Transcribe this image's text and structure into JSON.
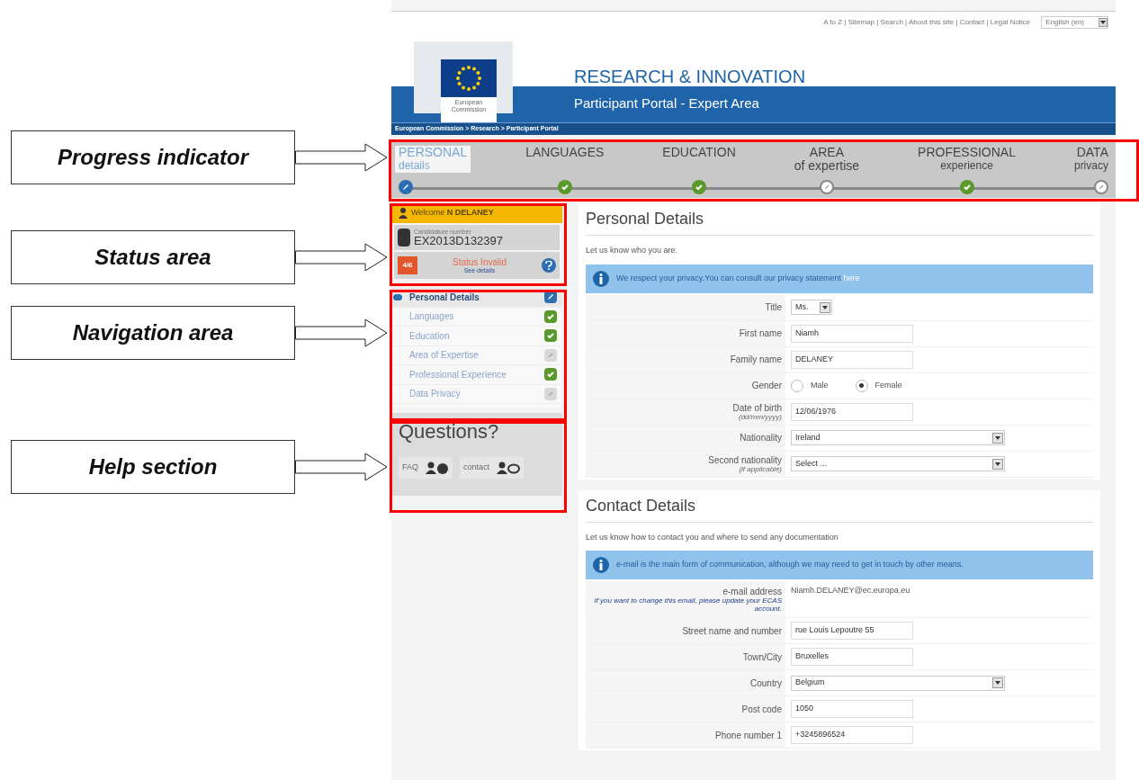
{
  "annotations": [
    {
      "label": "Progress indicator"
    },
    {
      "label": "Status area"
    },
    {
      "label": "Navigation area"
    },
    {
      "label": "Help section"
    }
  ],
  "top_links": "A to Z | Sitemap | Search | About this site | Contact | Legal Notice",
  "language": "English (en)",
  "logo_text": "European Commission",
  "site_title": "RESEARCH & INNOVATION",
  "site_subtitle": "Participant Portal - Expert Area",
  "breadcrumb": "European Commission > Research > Participant Portal",
  "steps": [
    {
      "title": "PERSONAL",
      "subtitle": "details",
      "selected": true,
      "kind": "editing"
    },
    {
      "title": "LANGUAGES",
      "selected": false,
      "kind": "complete"
    },
    {
      "title": "EDUCATION",
      "selected": false,
      "kind": "complete"
    },
    {
      "title": "AREA",
      "subtitle": "of expertise",
      "selected": false,
      "kind": "incomplete"
    },
    {
      "title": "PROFESSIONAL",
      "subtitle": "experience",
      "selected": false,
      "kind": "complete"
    },
    {
      "title": "DATA",
      "subtitle": "privacy",
      "selected": false,
      "kind": "incomplete"
    }
  ],
  "status_area": {
    "welcome": "Welcome **N DELANEY**",
    "candidature_label": "Candidature number",
    "candidature_number": "EX2013D132397",
    "progress": "4/6",
    "status": "Status Invalid",
    "status_link": "See details"
  },
  "nav": [
    {
      "label": "Personal Details",
      "selected": true,
      "kind": "editing"
    },
    {
      "label": "Languages",
      "selected": false,
      "kind": "complete"
    },
    {
      "label": "Education",
      "selected": false,
      "kind": "complete"
    },
    {
      "label": "Area of Expertise",
      "selected": false,
      "kind": "incomplete"
    },
    {
      "label": "Professional Experience",
      "selected": false,
      "kind": "complete"
    },
    {
      "label": "Data Privacy",
      "selected": false,
      "kind": "incomplete"
    }
  ],
  "help": {
    "title": "Questions?",
    "links": [
      {
        "label": "FAQ",
        "kind": "faq"
      },
      {
        "label": "contact",
        "kind": "contact"
      }
    ]
  },
  "sections": [
    {
      "title": "Personal Details",
      "intro": "Let us know who you are.",
      "info": "We respect your privacy.You can consult our privacy statement",
      "info_link": "here",
      "fields": [
        {
          "label": "Title",
          "kind": "small_select",
          "value": "Ms."
        },
        {
          "label": "First name",
          "kind": "text",
          "value": "Niamh"
        },
        {
          "label": "Family name",
          "kind": "text",
          "value": "DELANEY"
        },
        {
          "label": "Gender",
          "kind": "radio",
          "options": [
            {
              "label": "Male",
              "selected": false
            },
            {
              "label": "Female",
              "selected": true
            }
          ]
        },
        {
          "label": "Date of birth",
          "hint": "(dd/mm/yyyy)",
          "kind": "text",
          "value": "12/06/1976"
        },
        {
          "label": "Nationality",
          "kind": "select",
          "value": "Ireland"
        },
        {
          "label": "Second nationality",
          "hint": "(if applicable)",
          "kind": "select",
          "value": "Select ..."
        }
      ]
    },
    {
      "title": "Contact Details",
      "intro": "Let us know how to contact you and where to send any documentation",
      "info": "e-mail is the main form of communication, although we may need to get in touch by other means.",
      "fields": [
        {
          "label": "e-mail address",
          "hint": "If you want to change this email, please update your ECAS account.",
          "kind": "static",
          "value": "Niamh.DELANEY@ec.europa.eu"
        },
        {
          "label": "Street name and number",
          "kind": "text",
          "value": "rue Louis Lepoutre 55"
        },
        {
          "label": "Town/City",
          "kind": "text",
          "value": "Bruxelles"
        },
        {
          "label": "Country",
          "kind": "select",
          "value": "Belgium"
        },
        {
          "label": "Post code",
          "kind": "text",
          "value": "1050"
        },
        {
          "label": "Phone number 1",
          "kind": "text",
          "value": "+3245896524"
        }
      ]
    }
  ]
}
